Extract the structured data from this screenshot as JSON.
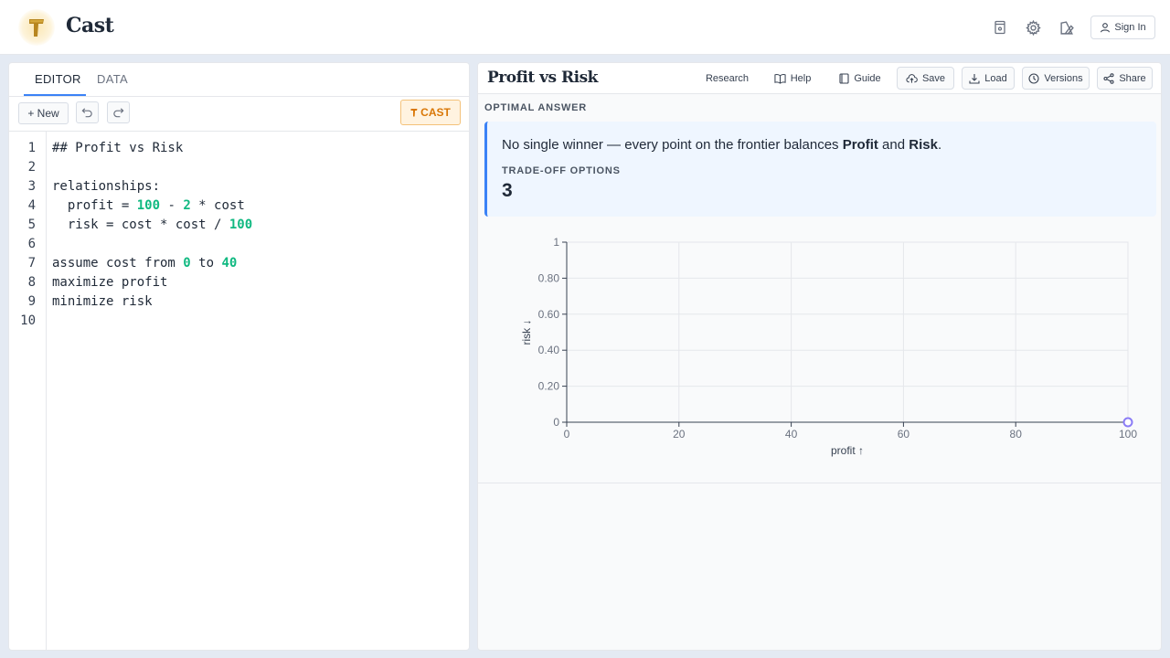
{
  "app": {
    "title": "Cast"
  },
  "header": {
    "sign_in": "Sign In",
    "icons": [
      "book-icon",
      "gear-icon",
      "theme-icon",
      "user-icon"
    ]
  },
  "left": {
    "tabs": [
      {
        "label": "EDITOR",
        "active": true
      },
      {
        "label": "DATA",
        "active": false
      }
    ],
    "toolbar": {
      "new_label": "+ New",
      "cast_label": "CAST"
    },
    "code": [
      [
        {
          "t": "## Profit vs Risk"
        }
      ],
      [],
      [
        {
          "t": "relationships:"
        }
      ],
      [
        {
          "t": "  profit = "
        },
        {
          "t": "100",
          "n": true
        },
        {
          "t": " - "
        },
        {
          "t": "2",
          "n": true
        },
        {
          "t": " * cost"
        }
      ],
      [
        {
          "t": "  risk = cost * cost / "
        },
        {
          "t": "100",
          "n": true
        }
      ],
      [],
      [
        {
          "t": "assume cost from "
        },
        {
          "t": "0",
          "n": true
        },
        {
          "t": " to "
        },
        {
          "t": "40",
          "n": true
        }
      ],
      [
        {
          "t": "maximize profit"
        }
      ],
      [
        {
          "t": "minimize risk"
        }
      ],
      []
    ]
  },
  "right": {
    "title": "Profit vs Risk",
    "buttons": {
      "research": "Research",
      "help": "Help",
      "guide": "Guide",
      "save": "Save",
      "load": "Load",
      "versions": "Versions",
      "share": "Share"
    },
    "optimal_label": "OPTIMAL ANSWER",
    "answer": {
      "prefix": "No single winner — every point on the frontier balances ",
      "a": "Profit",
      "mid": " and ",
      "b": "Risk",
      "suffix": "."
    },
    "trade_label": "TRADE-OFF OPTIONS",
    "trade_value": "3"
  },
  "chart_data": {
    "type": "scatter",
    "xlabel": "profit ↑",
    "ylabel": "risk ↓",
    "xlim": [
      0,
      100
    ],
    "ylim": [
      0,
      1
    ],
    "x_ticks": [
      "0",
      "20",
      "40",
      "60",
      "80",
      "100"
    ],
    "y_ticks": [
      "0",
      "0.20",
      "0.40",
      "0.60",
      "0.80",
      "1"
    ],
    "grid": true,
    "points": [
      {
        "x": 100,
        "y": 0
      }
    ],
    "colors": {
      "point": "#8b7cf6",
      "grid": "#e5e7eb",
      "axis": "#374151"
    }
  }
}
